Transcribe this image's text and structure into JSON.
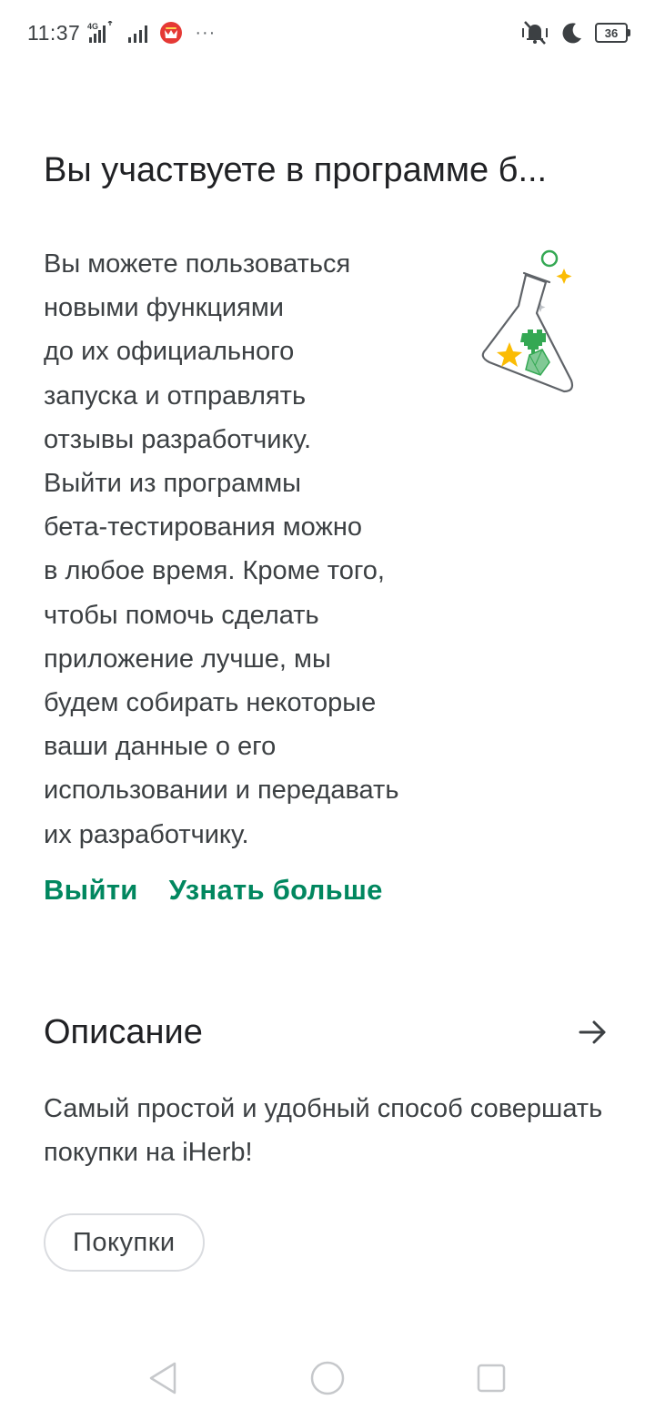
{
  "status_bar": {
    "time": "11:37",
    "network": "4G",
    "battery": "36",
    "more": "···"
  },
  "beta": {
    "title": "Вы участвуете в программе б...",
    "body": "Вы можете пользоваться\nновыми функциями\nдо их официального\nзапуска и отправлять\nотзывы разработчику.\nВыйти из программы\nбета-тестирования можно\nв любое время. Кроме того,\nчтобы помочь сделать\nприложение лучше, мы\nбудем собирать некоторые\nваши данные о его\nиспользовании и передавать\nих разработчику.",
    "leave_label": "Выйти",
    "learn_more_label": "Узнать больше"
  },
  "description": {
    "title": "Описание",
    "text": "Самый простой и удобный способ совершать покупки на iHerb!",
    "category_chip": "Покупки"
  },
  "colors": {
    "accent": "#01875f",
    "text_primary": "#202124",
    "text_secondary": "#3c4043",
    "chip_border": "#dadce0"
  },
  "icons": {
    "status_notification": "app-notification-icon",
    "status_mute": "vibrate-off-icon",
    "status_dnd": "moon-icon",
    "section_arrow": "arrow-right-icon",
    "illustration": "beta-flask-icon",
    "nav_back": "back-triangle-icon",
    "nav_home": "home-circle-icon",
    "nav_recents": "recents-square-icon"
  }
}
